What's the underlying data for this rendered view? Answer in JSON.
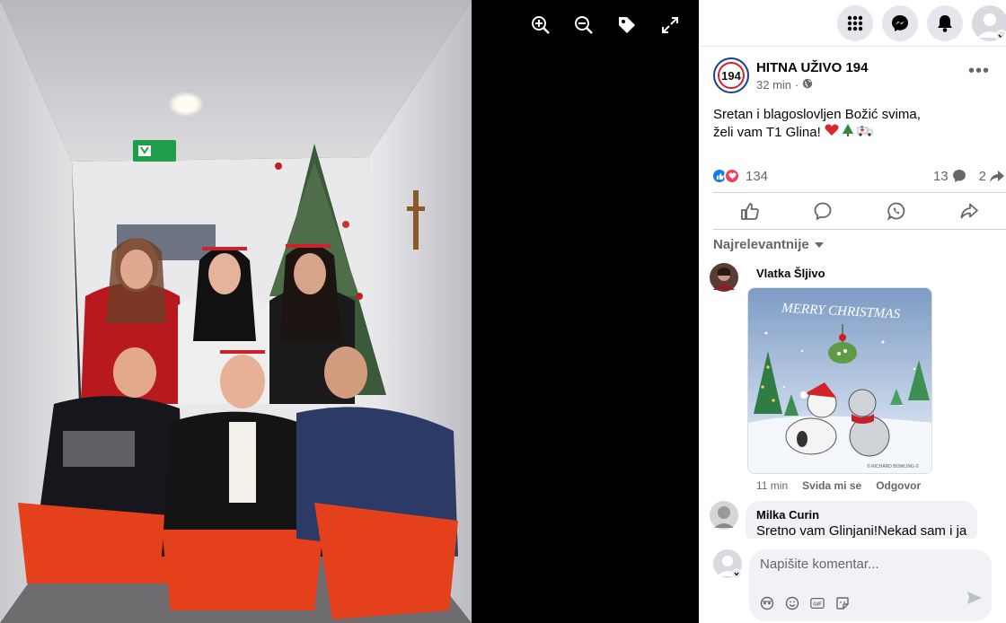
{
  "viewer": {
    "tools": [
      "zoom-in",
      "zoom-out",
      "tag",
      "fullscreen"
    ],
    "exit_sign_color": "#1f9e4a"
  },
  "post": {
    "page_name": "HITNA UŽIVO 194",
    "page_avatar_text": "194",
    "time": "32 min",
    "separator": "·",
    "text_line1": "Sretan i blagoslovljen Božić svima,",
    "text_line2": "želi vam T1 Glina!",
    "reaction_count": "134",
    "comment_count": "13",
    "share_count": "2"
  },
  "sort_label": "Najrelevantnije",
  "comments": [
    {
      "name": "Vlatka Šljivo",
      "sticker_title": "MERRY CHRISTMAS",
      "sticker_credit": "© RICHARD BOWLING ©",
      "time": "11 min",
      "like_label": "Svida mi se",
      "reply_label": "Odgovor"
    },
    {
      "name": "Milka Curin",
      "text": "Sretno vam Glinjani!Nekad sam i ja"
    }
  ],
  "composer": {
    "placeholder": "Napišite komentar..."
  },
  "colors": {
    "facebook_blue": "#1877f2",
    "love_red": "#f33e58",
    "panel_bg": "#ffffff",
    "bubble_bg": "#f0f2f5"
  }
}
